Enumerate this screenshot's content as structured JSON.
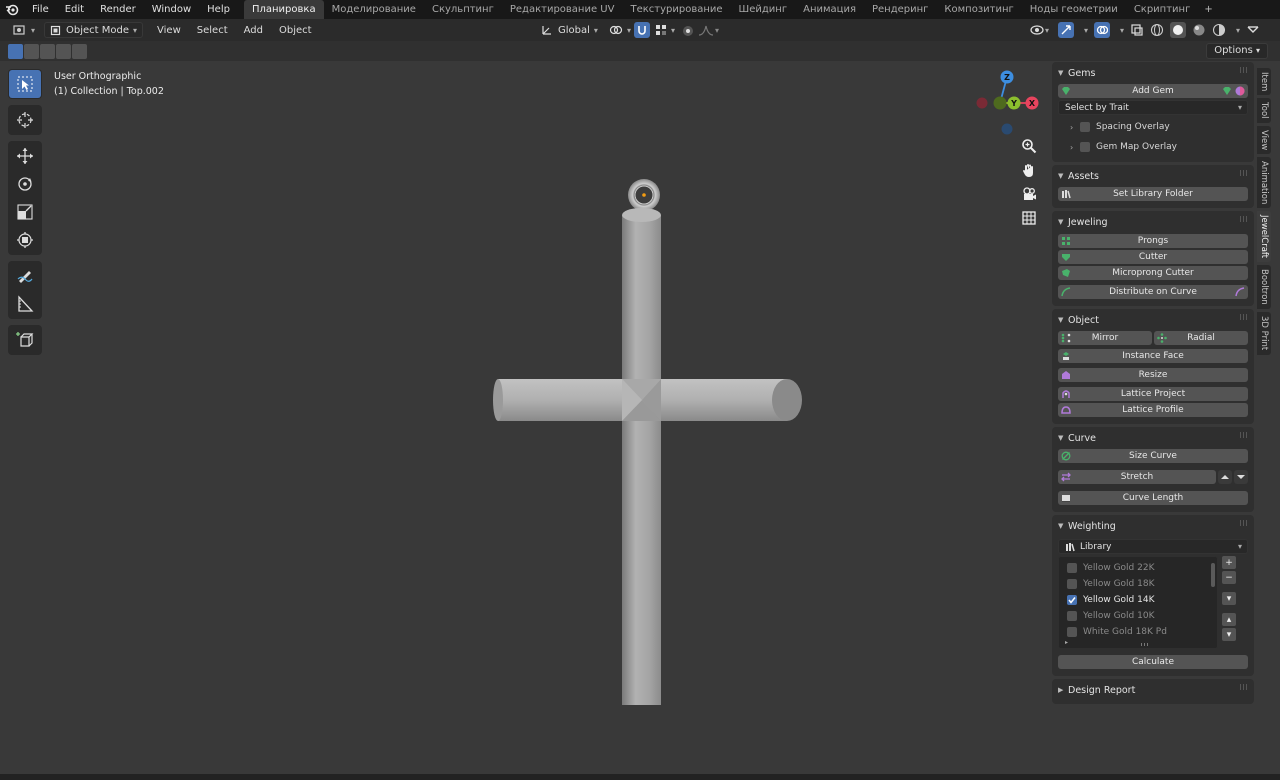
{
  "menu": {
    "items": [
      "File",
      "Edit",
      "Render",
      "Window",
      "Help"
    ]
  },
  "workspaces": {
    "tabs": [
      "Планировка",
      "Моделирование",
      "Скульптинг",
      "Редактирование UV",
      "Текстурирование",
      "Шейдинг",
      "Анимация",
      "Рендеринг",
      "Композитинг",
      "Ноды геометрии",
      "Скриптинг"
    ],
    "active_index": 0,
    "add": "+"
  },
  "header": {
    "mode": "Object Mode",
    "menus": [
      "View",
      "Select",
      "Add",
      "Object"
    ],
    "transform_orientation": "Global"
  },
  "options_label": "Options",
  "viewport": {
    "view_name": "User Orthographic",
    "collection_info": "(1) Collection | Top.002"
  },
  "gizmo": {
    "x": "X",
    "y": "Y",
    "z": "Z"
  },
  "sidebar": {
    "gems": {
      "title": "Gems",
      "add_gem": "Add Gem",
      "select_by_trait": "Select by Trait",
      "spacing_overlay": "Spacing Overlay",
      "gem_map_overlay": "Gem Map Overlay"
    },
    "assets": {
      "title": "Assets",
      "set_library_folder": "Set Library Folder"
    },
    "jeweling": {
      "title": "Jeweling",
      "prongs": "Prongs",
      "cutter": "Cutter",
      "microprong_cutter": "Microprong Cutter",
      "distribute_on_curve": "Distribute on Curve"
    },
    "object": {
      "title": "Object",
      "mirror": "Mirror",
      "radial": "Radial",
      "instance_face": "Instance Face",
      "resize": "Resize",
      "lattice_project": "Lattice Project",
      "lattice_profile": "Lattice Profile"
    },
    "curve": {
      "title": "Curve",
      "size_curve": "Size Curve",
      "stretch": "Stretch",
      "curve_length": "Curve Length"
    },
    "weighting": {
      "title": "Weighting",
      "library": "Library",
      "materials": [
        {
          "name": "Yellow Gold 22K",
          "checked": false
        },
        {
          "name": "Yellow Gold 18K",
          "checked": false
        },
        {
          "name": "Yellow Gold 14K",
          "checked": true
        },
        {
          "name": "Yellow Gold 10K",
          "checked": false
        },
        {
          "name": "White Gold 18K Pd",
          "checked": false
        }
      ],
      "calculate": "Calculate"
    },
    "design_report": {
      "title": "Design Report"
    }
  },
  "vertical_tabs": [
    "Item",
    "Tool",
    "View",
    "Animation",
    "JewelCraft",
    "Booltron",
    "3D Print"
  ],
  "vertical_tab_active": 4,
  "colors": {
    "accent_blue": "#4772b3",
    "axis_x": "#e8445e",
    "axis_y": "#8cbf2e",
    "axis_z": "#3d8ee0",
    "gem_green": "#49b26b",
    "purple_icon": "#b07ad9"
  }
}
